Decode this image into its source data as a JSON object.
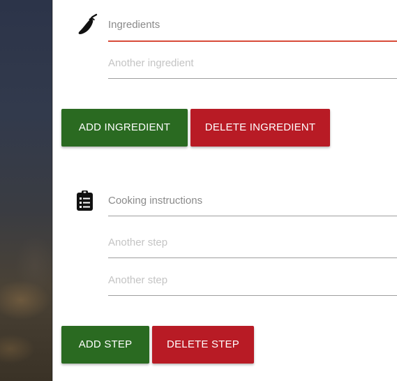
{
  "ingredients": {
    "icon": "chili-pepper-icon",
    "label": "Ingredients",
    "placeholder": "Another ingredient",
    "add_label": "ADD INGREDIENT",
    "delete_label": "DELETE INGREDIENT"
  },
  "instructions": {
    "icon": "clipboard-list-icon",
    "label": "Cooking instructions",
    "step_placeholders": [
      "Another step",
      "Another step"
    ],
    "add_label": "ADD STEP",
    "delete_label": "DELETE STEP"
  },
  "colors": {
    "primary_green": "#2a6a21",
    "danger_red": "#b81b25",
    "active_underline": "#d84a38"
  }
}
